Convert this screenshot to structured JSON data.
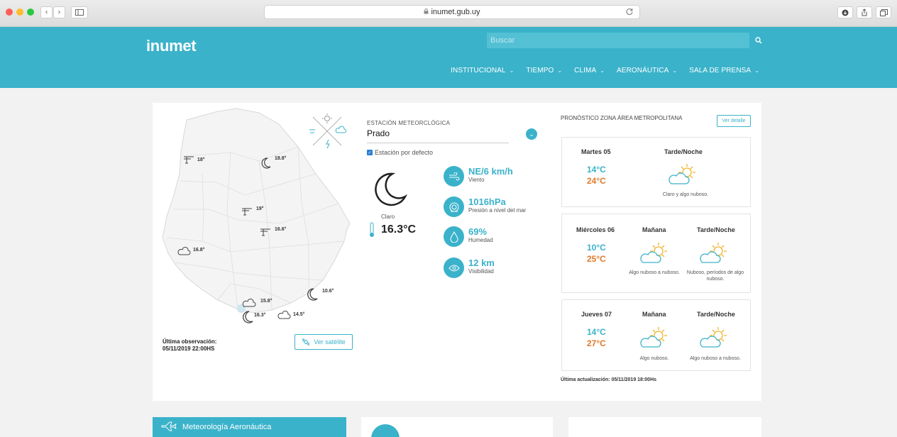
{
  "browser": {
    "url": "inumet.gub.uy",
    "back_glyph": "‹",
    "forward_glyph": "›"
  },
  "site": {
    "logo": "inumet",
    "search_placeholder": "Buscar",
    "nav": [
      "INSTITUCIONAL",
      "TIEMPO",
      "CLIMA",
      "AERONÁUTICA",
      "SALA DE PRENSA"
    ]
  },
  "map": {
    "stations": [
      {
        "label": "18°",
        "kind": "wind"
      },
      {
        "label": "18.8°",
        "kind": "moon"
      },
      {
        "label": "19°",
        "kind": "wind"
      },
      {
        "label": "16.6°",
        "kind": "wind"
      },
      {
        "label": "16.8°",
        "kind": "cloud-moon"
      },
      {
        "label": "10.6°",
        "kind": "moon"
      },
      {
        "label": "15.8°",
        "kind": "cloud-moon"
      },
      {
        "label": "16.3°",
        "kind": "moon"
      },
      {
        "label": "14.5°",
        "kind": "cloud-moon"
      }
    ],
    "last_obs_title": "Última observación:",
    "last_obs_value": "05/11/2019 22:00HS",
    "satellite_button": "Ver satélite"
  },
  "station": {
    "label": "ESTACIÓN METEORCLÓGICA",
    "value": "Prado",
    "default_checkbox": "Estación por defecto",
    "condition": "Claro",
    "temperature": "16.3°C"
  },
  "metrics": [
    {
      "value": "NE/6 km/h",
      "label": "Viento",
      "icon": "wind-icon"
    },
    {
      "value": "1016hPa",
      "label": "Presión a nivel del mar",
      "icon": "pressure-icon"
    },
    {
      "value": "69%",
      "label": "Humedad",
      "icon": "humidity-icon"
    },
    {
      "value": "12 km",
      "label": "Visibilidad",
      "icon": "eye-icon"
    }
  ],
  "forecast": {
    "title": "PRONÓSTICO ZONA ÁREA METROPOLITANA",
    "detail_button": "Ver detalle",
    "days": [
      {
        "day": "Martes 05",
        "min": "14°C",
        "max": "24°C",
        "periods": [
          {
            "name": "Tarde/Noche",
            "desc": "Claro y algo nuboso."
          }
        ]
      },
      {
        "day": "Miércoles 06",
        "min": "10°C",
        "max": "25°C",
        "periods": [
          {
            "name": "Mañana",
            "desc": "Algo nuboso a nuboso."
          },
          {
            "name": "Tarde/Noche",
            "desc": "Nuboso, períodos de algo nuboso."
          }
        ]
      },
      {
        "day": "Jueves 07",
        "min": "14°C",
        "max": "27°C",
        "periods": [
          {
            "name": "Mañana",
            "desc": "Algo nuboso."
          },
          {
            "name": "Tarde/Noche",
            "desc": "Algo nuboso a nuboso."
          }
        ]
      }
    ],
    "updated": "Última actualización: 05/11/2019 18:00Hs"
  },
  "bottom": {
    "aero_title": "Meteorología Aeronáutica"
  },
  "colors": {
    "brand": "#3ab2ca",
    "min_temp": "#3ab2ca",
    "max_temp": "#e07a2a"
  }
}
